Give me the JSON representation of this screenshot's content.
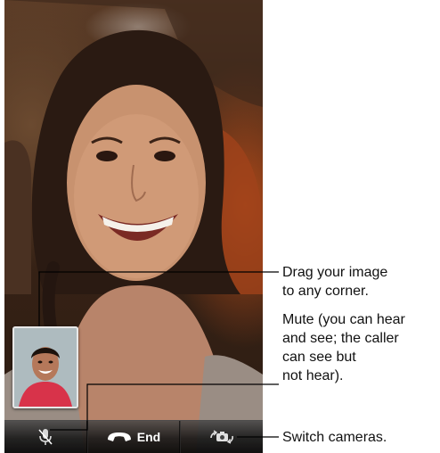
{
  "toolbar": {
    "end_label": "End",
    "mute_icon": "microphone-mute-icon",
    "end_icon": "phone-handset-icon",
    "switch_icon": "camera-switch-icon"
  },
  "callouts": {
    "drag": [
      "Drag your image",
      "to any corner."
    ],
    "mute": [
      "Mute (you can hear",
      "and see; the caller",
      "can see but",
      "not hear)."
    ],
    "switch": [
      "Switch cameras."
    ]
  },
  "colors": {
    "end_red": "#e8282a",
    "callout_line": "#000000"
  }
}
